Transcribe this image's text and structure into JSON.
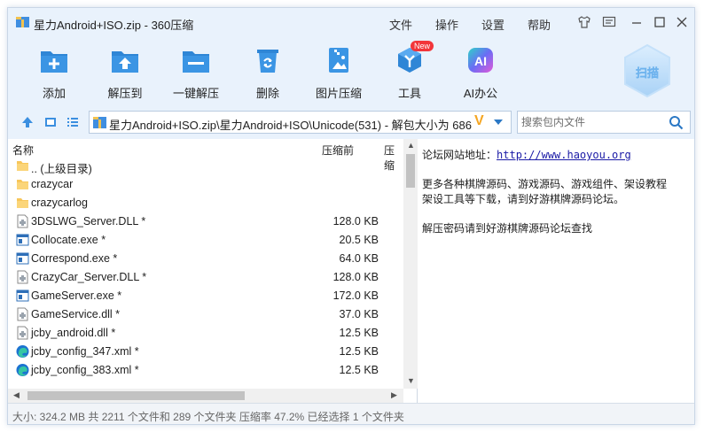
{
  "window": {
    "title": "星力Android+ISO.zip - 360压缩",
    "menu": [
      "文件",
      "操作",
      "设置",
      "帮助"
    ]
  },
  "toolbar": {
    "tools": [
      {
        "label": "添加",
        "icon": "add-icon"
      },
      {
        "label": "解压到",
        "icon": "extract-to-icon"
      },
      {
        "label": "一键解压",
        "icon": "one-click-extract-icon"
      },
      {
        "label": "删除",
        "icon": "delete-icon"
      },
      {
        "label": "图片压缩",
        "icon": "image-compress-icon"
      },
      {
        "label": "工具",
        "icon": "tools-icon"
      },
      {
        "label": "AI办公",
        "icon": "ai-office-icon"
      }
    ],
    "new_badge": "New",
    "scan_label": "扫描",
    "ai_glyph": "AI"
  },
  "address": {
    "path": "星力Android+ISO.zip\\星力Android+ISO\\Unicode(531) - 解包大小为 686",
    "search_placeholder": "搜索包内文件"
  },
  "filelist": {
    "columns": {
      "name": "名称",
      "size": "压缩前",
      "packed": "压缩"
    },
    "rows": [
      {
        "name": ".. (上级目录)",
        "size": "",
        "type": "folder"
      },
      {
        "name": "crazycar",
        "size": "",
        "type": "folder"
      },
      {
        "name": "crazycarlog",
        "size": "",
        "type": "folder"
      },
      {
        "name": "3DSLWG_Server.DLL *",
        "size": "128.0 KB",
        "type": "dll"
      },
      {
        "name": "Collocate.exe *",
        "size": "20.5 KB",
        "type": "exe"
      },
      {
        "name": "Correspond.exe *",
        "size": "64.0 KB",
        "type": "exe"
      },
      {
        "name": "CrazyCar_Server.DLL *",
        "size": "128.0 KB",
        "type": "dll"
      },
      {
        "name": "GameServer.exe *",
        "size": "172.0 KB",
        "type": "exe"
      },
      {
        "name": "GameService.dll *",
        "size": "37.0 KB",
        "type": "dll"
      },
      {
        "name": "jcby_android.dll *",
        "size": "12.5 KB",
        "type": "dll"
      },
      {
        "name": "jcby_config_347.xml *",
        "size": "12.5 KB",
        "type": "xml"
      },
      {
        "name": "jcby_config_383.xml *",
        "size": "12.5 KB",
        "type": "xml"
      }
    ]
  },
  "comment": {
    "line1_label": "论坛网站地址：",
    "line1_link": "http://www.haoyou.org",
    "line2": "更多各种棋牌源码、游戏源码、游戏组件、架设教程",
    "line3": "架设工具等下载，请到好游棋牌源码论坛。",
    "line4": "解压密码请到好游棋牌源码论坛查找"
  },
  "status": {
    "text": "大小: 324.2 MB 共 2211 个文件和 289 个文件夹 压缩率 47.2% 已经选择 1 个文件夹"
  },
  "colors": {
    "chrome_bg": "#e9f2fc",
    "accent_blue": "#2b78c5",
    "folder_yellow": "#f7c65a"
  }
}
